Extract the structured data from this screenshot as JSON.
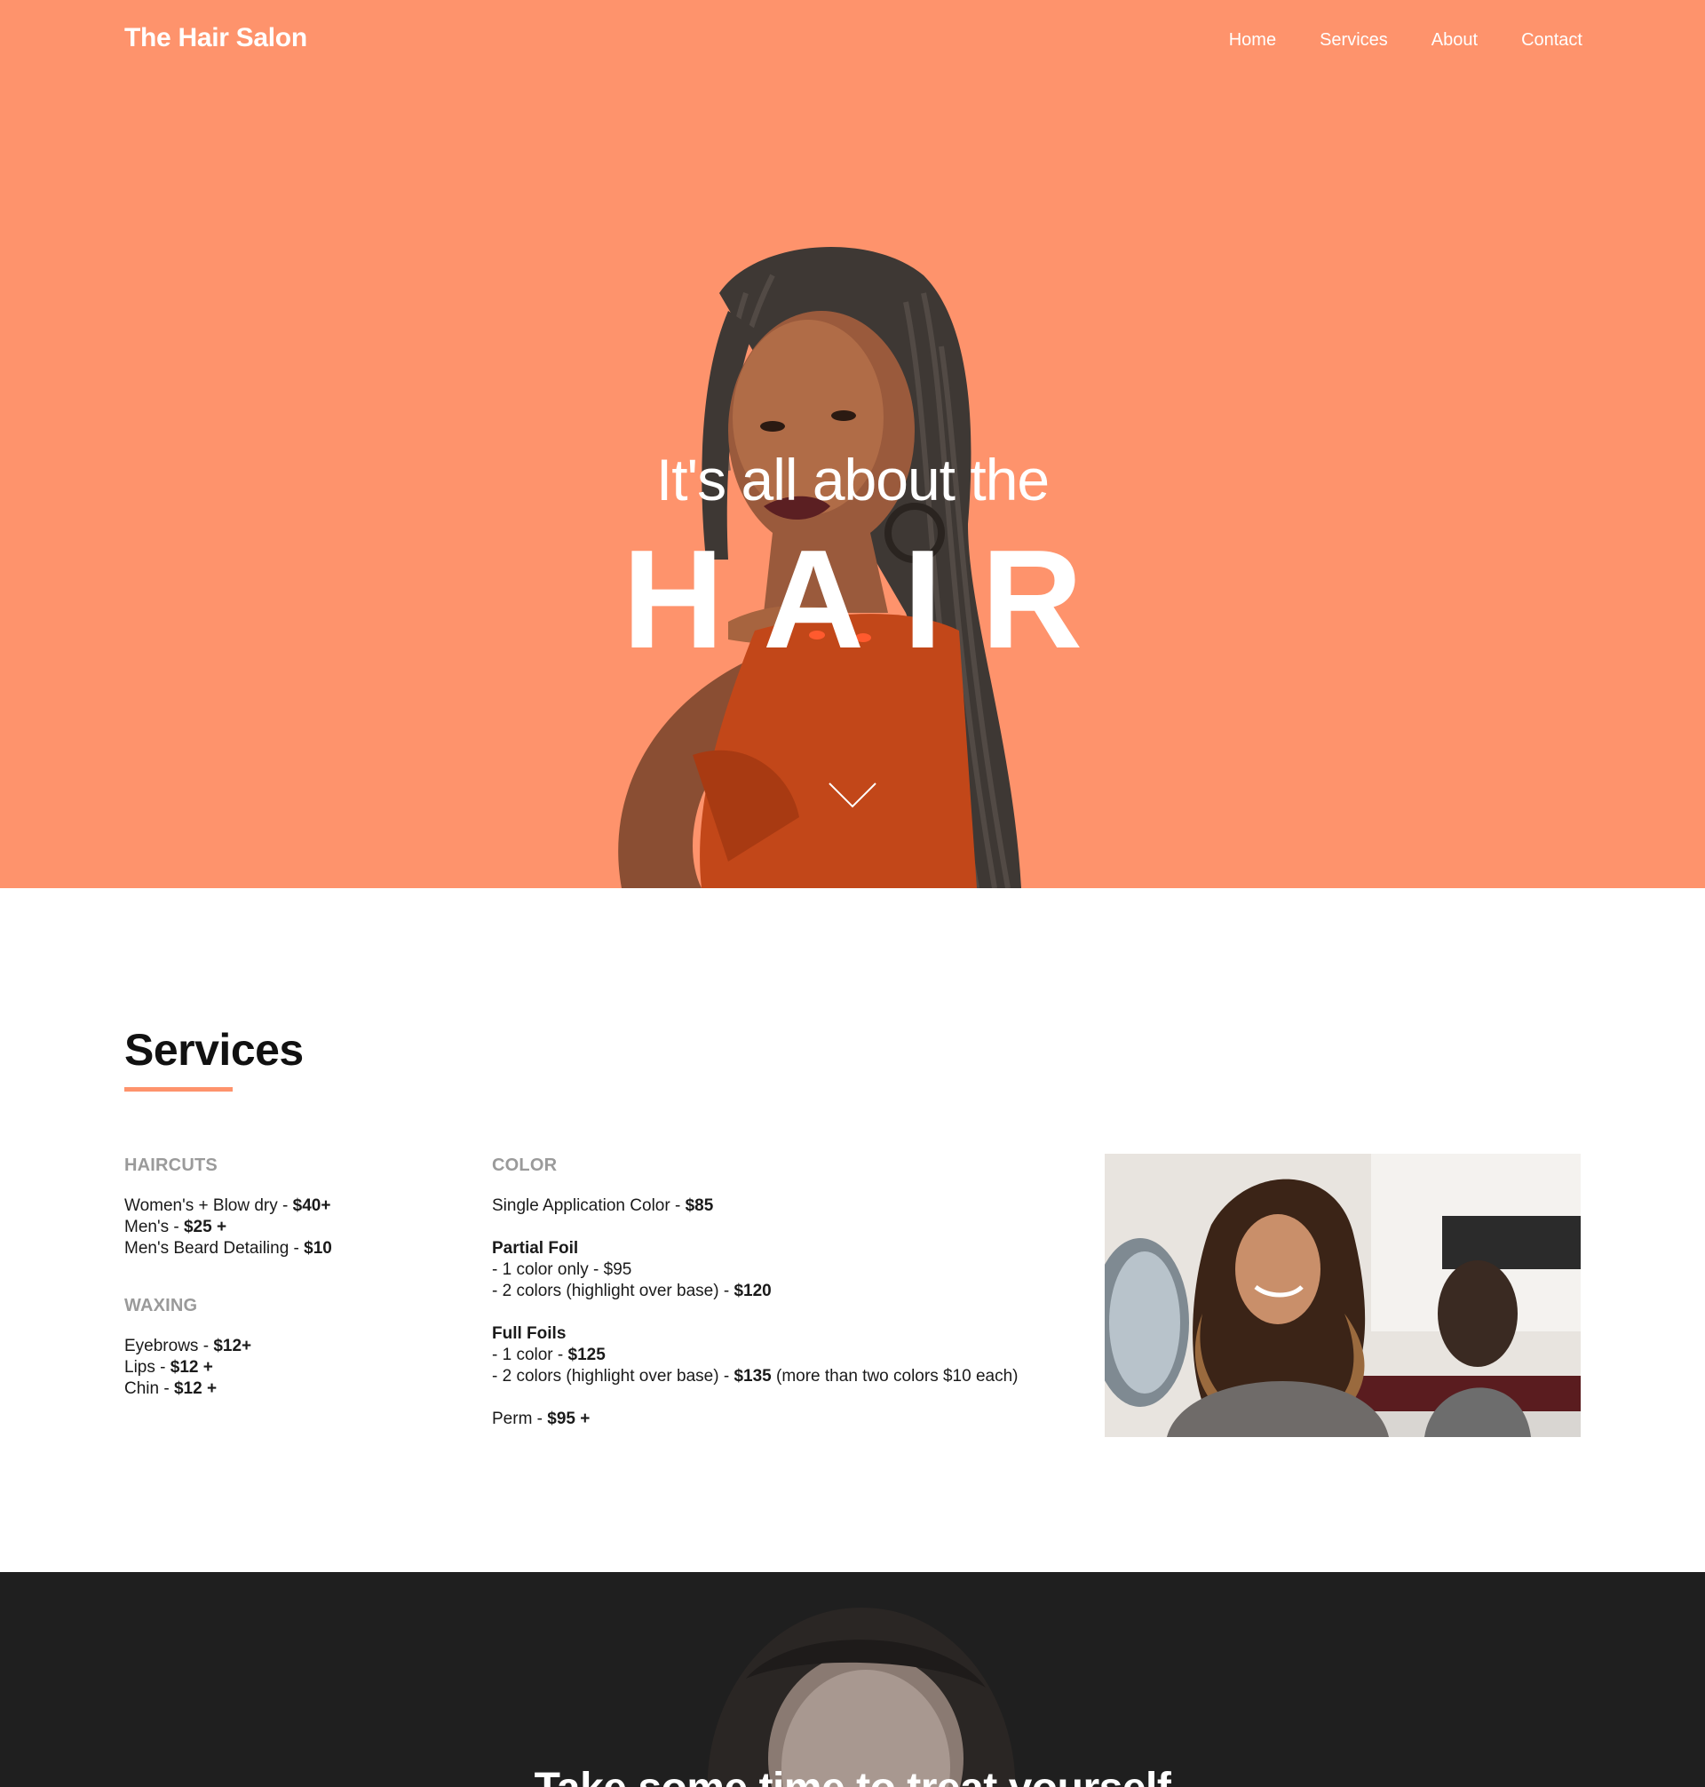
{
  "nav": {
    "brand": "The Hair Salon",
    "links": [
      "Home",
      "Services",
      "About",
      "Contact"
    ]
  },
  "hero": {
    "subtitle": "It's all about the",
    "title": "HAIR",
    "scroll_icon": "chevron-down-icon"
  },
  "services": {
    "title": "Services",
    "haircuts": {
      "heading": "HAIRCUTS",
      "items": [
        {
          "label": "Women's + Blow dry - ",
          "price": "$40+"
        },
        {
          "label": "Men's - ",
          "price": "$25 +"
        },
        {
          "label": "Men's Beard Detailing - ",
          "price": "$10"
        }
      ]
    },
    "waxing": {
      "heading": "WAXING",
      "items": [
        {
          "label": "Eyebrows - ",
          "price": "$12+"
        },
        {
          "label": "Lips - ",
          "price": "$12 +"
        },
        {
          "label": "Chin - ",
          "price": "$12 +"
        }
      ]
    },
    "color": {
      "heading": "COLOR",
      "single": {
        "label": "Single Application Color - ",
        "price": "$85"
      },
      "partial_foil": {
        "title": "Partial Foil",
        "line1": "- 1 color only - $95",
        "line2_label": "- 2 colors (highlight over base) - ",
        "line2_price": "$120"
      },
      "full_foils": {
        "title": "Full Foils",
        "line1_label": "- 1 color - ",
        "line1_price": "$125",
        "line2_label": "- 2 colors (highlight over base) - ",
        "line2_price": "$135",
        "line2_note": " (more than two colors $10 each)"
      },
      "perm": {
        "label": "Perm - ",
        "price": "$95 +"
      }
    }
  },
  "banner": {
    "title": "Take some time to treat yourself"
  },
  "colors": {
    "accent": "#fe936c",
    "dark": "#1f1f1f",
    "muted": "#9a9a9a"
  }
}
